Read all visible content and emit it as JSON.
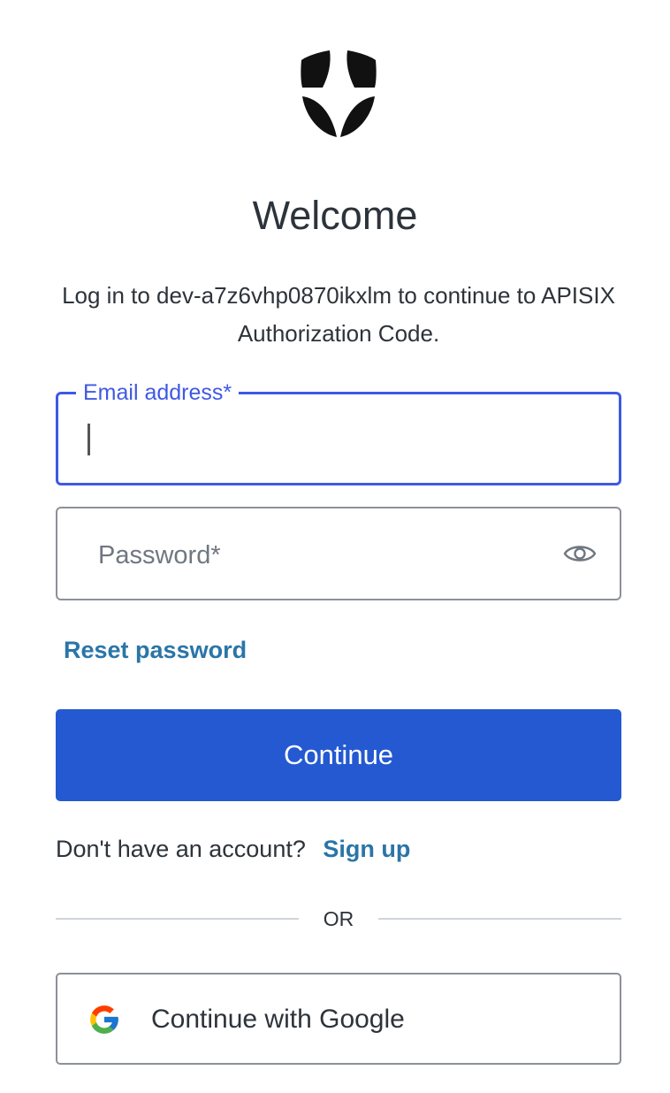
{
  "header": {
    "logo_icon": "shield-logo-icon",
    "title": "Welcome",
    "subtitle": "Log in to dev-a7z6vhp0870ikxlm to continue to APISIX Authorization Code."
  },
  "form": {
    "email": {
      "label": "Email address*",
      "value": ""
    },
    "password": {
      "placeholder": "Password*",
      "toggle_icon": "eye-icon"
    },
    "reset_password_label": "Reset password",
    "continue_label": "Continue"
  },
  "signup": {
    "prompt": "Don't have an account?",
    "link_label": "Sign up"
  },
  "divider": {
    "text": "OR"
  },
  "social": {
    "google_label": "Continue with Google",
    "google_icon": "google-icon"
  },
  "colors": {
    "primary_button": "#2459d1",
    "link": "#2a75a8",
    "focus_border": "#3f59e4",
    "text": "#2d333a"
  }
}
